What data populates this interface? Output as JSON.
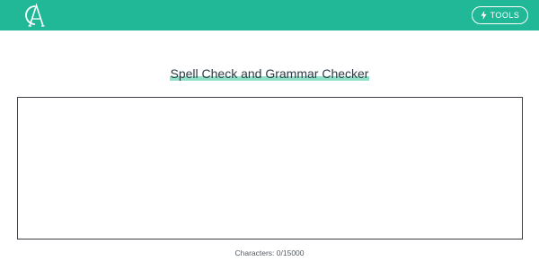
{
  "header": {
    "logo_label": "CA",
    "tools_label": "TOOLS",
    "tools_icon": "bolt-icon"
  },
  "main": {
    "title": "Spell Check and Grammar Checker",
    "editor_value": "",
    "char_count_label": "Characters: 0/15000"
  },
  "colors": {
    "header_bg": "#20b896",
    "title_highlight": "#8fe0c6",
    "editor_border": "#3a3f47"
  }
}
